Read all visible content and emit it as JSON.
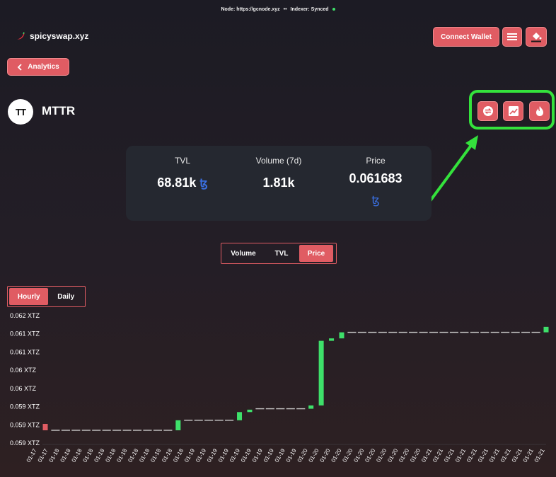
{
  "topbar": {
    "node_text": "Node: https://gcnode.xyz",
    "separator": "••",
    "indexer_text": "Indexer: Synced"
  },
  "brand": {
    "name": "spicyswap.xyz"
  },
  "header": {
    "connect_label": "Connect Wallet"
  },
  "nav": {
    "back_label": "Analytics"
  },
  "token": {
    "logo_text": "TT",
    "symbol": "MTTR"
  },
  "actions": {
    "icons": [
      "swap-icon",
      "chart-icon",
      "fire-icon"
    ]
  },
  "stats": {
    "tvl_label": "TVL",
    "tvl_value": "68.81k",
    "volume_label": "Volume (7d)",
    "volume_value": "1.81k",
    "price_label": "Price",
    "price_value": "0.061683",
    "tez_symbol": "ꜩ"
  },
  "metric_tabs": [
    {
      "label": "Volume",
      "active": false
    },
    {
      "label": "TVL",
      "active": false
    },
    {
      "label": "Price",
      "active": true
    }
  ],
  "time_tabs": [
    {
      "label": "Hourly",
      "active": true
    },
    {
      "label": "Daily",
      "active": false
    }
  ],
  "colors": {
    "accent": "#e05c63",
    "up": "#3ee06a",
    "down": "#e05c63",
    "highlight": "#34e23c"
  },
  "chart_data": {
    "type": "candlestick",
    "y_tick_labels": [
      "0.062 XTZ",
      "0.061 XTZ",
      "0.061 XTZ",
      "0.06 XTZ",
      "0.06 XTZ",
      "0.059 XTZ",
      "0.059 XTZ",
      "0.059 XTZ"
    ],
    "y_tick_values": [
      0.062,
      0.0614,
      0.0608,
      0.0602,
      0.0596,
      0.059,
      0.0584,
      0.0578
    ],
    "x_tick_labels": [
      "01-17",
      "01-17",
      "01-18",
      "01-18",
      "01-18",
      "01-18",
      "01-18",
      "01-18",
      "01-18",
      "01-18",
      "01-18",
      "01-18",
      "01-18",
      "01-18",
      "01-19",
      "01-19",
      "01-19",
      "01-19",
      "01-19",
      "01-19",
      "01-19",
      "01-19",
      "01-19",
      "01-19",
      "01-20",
      "01-20",
      "01-20",
      "01-20",
      "01-20",
      "01-20",
      "01-20",
      "01-20",
      "01-20",
      "01-20",
      "01-20",
      "01-21",
      "01-21",
      "01-21",
      "01-21",
      "01-21",
      "01-21",
      "01-21",
      "01-21",
      "01-21",
      "01-21",
      "01-21"
    ],
    "ylim": [
      0.0578,
      0.062
    ],
    "candles": [
      {
        "i": 0,
        "open": 0.05843,
        "close": 0.05822
      },
      {
        "i": 13,
        "open": 0.05822,
        "close": 0.05855
      },
      {
        "i": 19,
        "open": 0.05855,
        "close": 0.05882
      },
      {
        "i": 20,
        "open": 0.05882,
        "close": 0.0589
      },
      {
        "i": 26,
        "open": 0.05893,
        "close": 0.05904
      },
      {
        "i": 27,
        "open": 0.05904,
        "close": 0.06117
      },
      {
        "i": 28,
        "open": 0.06117,
        "close": 0.06125
      },
      {
        "i": 29,
        "open": 0.06125,
        "close": 0.06145
      },
      {
        "i": 49,
        "open": 0.06145,
        "close": 0.06163
      }
    ],
    "flat_segments": [
      {
        "from": 1,
        "to": 12,
        "value": 0.05822
      },
      {
        "from": 14,
        "to": 18,
        "value": 0.05855
      },
      {
        "from": 21,
        "to": 25,
        "value": 0.05893
      },
      {
        "from": 30,
        "to": 48,
        "value": 0.06145
      }
    ]
  }
}
